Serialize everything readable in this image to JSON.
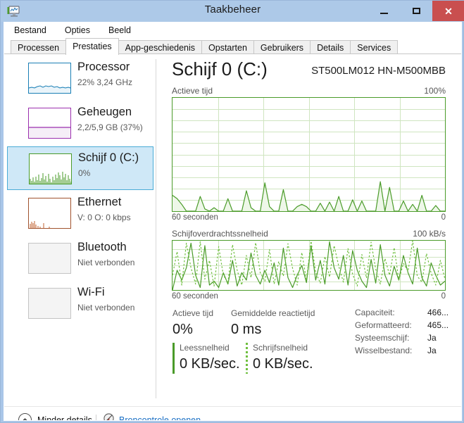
{
  "window": {
    "title": "Taakbeheer",
    "icon": "task-manager-icon",
    "minimize_label": "–",
    "maximize_label": "",
    "close_label": "✕"
  },
  "menu": {
    "items": [
      {
        "label": "Bestand"
      },
      {
        "label": "Opties"
      },
      {
        "label": "Beeld"
      }
    ]
  },
  "tabs": {
    "items": [
      {
        "label": "Processen",
        "active": false
      },
      {
        "label": "Prestaties",
        "active": true
      },
      {
        "label": "App-geschiedenis",
        "active": false
      },
      {
        "label": "Opstarten",
        "active": false
      },
      {
        "label": "Gebruikers",
        "active": false
      },
      {
        "label": "Details",
        "active": false
      },
      {
        "label": "Services",
        "active": false
      }
    ]
  },
  "sidebar": {
    "items": [
      {
        "name": "processor",
        "label": "Processor",
        "sub": "22% 3,24 GHz",
        "selected": false,
        "color": "#1a7fb5",
        "fill": "#eaf4fa",
        "kind": "line"
      },
      {
        "name": "memory",
        "label": "Geheugen",
        "sub": "2,2/5,9 GB (37%)",
        "selected": false,
        "color": "#9b2fae",
        "fill": "#f5eef7",
        "kind": "flat"
      },
      {
        "name": "disk-0-c",
        "label": "Schijf 0 (C:)",
        "sub": "0%",
        "selected": true,
        "color": "#4a9b29",
        "fill": "#ffffff",
        "kind": "spiky"
      },
      {
        "name": "ethernet",
        "label": "Ethernet",
        "sub_prefix": "V: ",
        "sub_v": "0",
        "sub_mid": " O: ",
        "sub_o": "0 kbps",
        "sub": "V: 0 O: 0 kbps",
        "selected": false,
        "color": "#a0522d",
        "fill": "#ffffff",
        "kind": "burst"
      },
      {
        "name": "bluetooth",
        "label": "Bluetooth",
        "sub": "Niet verbonden",
        "selected": false,
        "color": "#c4c4c4",
        "fill": "#f4f4f4",
        "kind": "empty"
      },
      {
        "name": "wifi",
        "label": "Wi-Fi",
        "sub": "Niet verbonden",
        "selected": false,
        "color": "#c4c4c4",
        "fill": "#f4f4f4",
        "kind": "empty"
      }
    ]
  },
  "main": {
    "title": "Schijf 0 (C:)",
    "model": "ST500LM012 HN-M500MBB",
    "graph1": {
      "caption": "Actieve tijd",
      "max_label": "100%",
      "left_axis": "60 seconden",
      "right_axis": "0"
    },
    "graph2": {
      "caption": "Schijfoverdrachtssnelheid",
      "max_label": "100 kB/s",
      "left_axis": "60 seconden",
      "right_axis": "0"
    },
    "stats": [
      {
        "caption": "Actieve tijd",
        "value": "0%"
      },
      {
        "caption": "Gemiddelde reactietijd",
        "value": "0 ms"
      }
    ],
    "rw": [
      {
        "caption": "Leessnelheid",
        "value": "0 KB/sec.",
        "style": "solid"
      },
      {
        "caption": "Schrijfsnelheid",
        "value": "0 KB/sec.",
        "style": "dotted"
      }
    ],
    "info": [
      {
        "key": "Capaciteit:",
        "value": "466..."
      },
      {
        "key": "Geformatteerd:",
        "value": "465..."
      },
      {
        "key": "Systeemschijf:",
        "value": "Ja"
      },
      {
        "key": "Wisselbestand:",
        "value": "Ja"
      }
    ]
  },
  "statusbar": {
    "less_details": "Minder details",
    "resource_monitor": "Broncontrole openen",
    "link_color": "#1a6fc4"
  },
  "chart_data": [
    {
      "type": "area",
      "title": "Actieve tijd",
      "ylabel": "%",
      "xlabel": "60 seconden",
      "ylim": [
        0,
        100
      ],
      "xlim": [
        60,
        0
      ],
      "grid": true,
      "series": [
        {
          "name": "Actieve tijd",
          "color": "#4a9b29",
          "fill": "#eef7e8",
          "values": [
            14,
            11,
            6,
            0,
            0,
            0,
            13,
            2,
            0,
            3,
            0,
            0,
            11,
            0,
            0,
            0,
            18,
            3,
            0,
            0,
            25,
            4,
            0,
            0,
            19,
            0,
            0,
            4,
            6,
            4,
            0,
            0,
            7,
            0,
            8,
            0,
            13,
            0,
            0,
            10,
            0,
            9,
            0,
            0,
            0,
            26,
            0,
            21,
            0,
            0,
            9,
            0,
            6,
            0,
            14,
            0,
            0,
            5,
            0,
            0
          ]
        }
      ]
    },
    {
      "type": "line",
      "title": "Schijfoverdrachtssnelheid",
      "ylabel": "kB/s",
      "xlabel": "60 seconden",
      "ylim": [
        0,
        100
      ],
      "xlim": [
        60,
        0
      ],
      "grid": true,
      "series": [
        {
          "name": "Leessnelheid",
          "color": "#4a9b29",
          "style": "solid",
          "values": [
            0,
            40,
            20,
            45,
            95,
            30,
            5,
            90,
            10,
            18,
            5,
            35,
            12,
            60,
            8,
            35,
            20,
            75,
            30,
            12,
            40,
            15,
            55,
            10,
            85,
            25,
            5,
            30,
            50,
            15,
            90,
            20,
            60,
            12,
            98,
            45,
            22,
            70,
            10,
            80,
            40,
            18,
            5,
            62,
            14,
            92,
            30,
            8,
            48,
            20,
            70,
            35,
            12,
            85,
            25,
            8,
            55,
            30,
            10,
            18
          ]
        },
        {
          "name": "Schrijfsnelheid",
          "color": "#6fbf3f",
          "style": "dotted",
          "values": [
            30,
            78,
            10,
            95,
            45,
            12,
            98,
            22,
            60,
            8,
            88,
            30,
            15,
            92,
            40,
            10,
            70,
            25,
            96,
            35,
            18,
            82,
            12,
            58,
            28,
            94,
            44,
            10,
            76,
            20,
            99,
            36,
            14,
            68,
            26,
            90,
            48,
            16,
            84,
            32,
            8,
            72,
            24,
            97,
            42,
            12,
            64,
            30,
            86,
            20,
            54,
            38,
            100,
            28,
            16,
            74,
            34,
            10,
            60,
            22
          ]
        }
      ]
    }
  ]
}
